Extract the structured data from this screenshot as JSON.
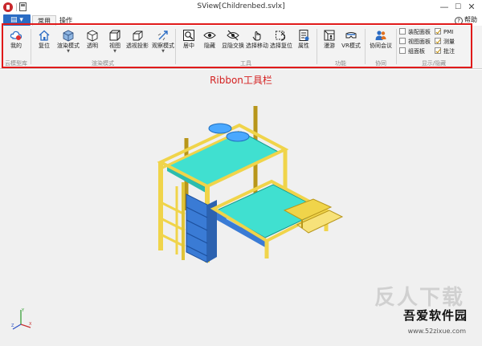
{
  "window": {
    "title": "SView[Childrenbed.svlx]"
  },
  "window_controls": {
    "minimize": "—",
    "maximize": "☐",
    "close": "✕"
  },
  "tabs": [
    {
      "label": "常用",
      "active": true
    },
    {
      "label": "操作",
      "active": false
    }
  ],
  "help": {
    "label": "帮助"
  },
  "ribbon": {
    "groups": [
      {
        "label": "云模型库",
        "buttons": [
          {
            "label": "我的",
            "icon": "cloud-icon"
          }
        ]
      },
      {
        "label": "渲染模式",
        "buttons": [
          {
            "label": "复位",
            "icon": "home-icon"
          },
          {
            "label": "渲染模式",
            "icon": "shaded-cube-icon",
            "dropdown": true
          },
          {
            "label": "透明",
            "icon": "transparent-cube-icon"
          },
          {
            "label": "视图",
            "icon": "view-cube-icon",
            "dropdown": true
          },
          {
            "label": "透视投影",
            "icon": "perspective-cube-icon"
          },
          {
            "label": "观察模式",
            "icon": "observe-mode-icon",
            "dropdown": true
          }
        ]
      },
      {
        "label": "工具",
        "buttons": [
          {
            "label": "居中",
            "icon": "center-icon"
          },
          {
            "label": "隐藏",
            "icon": "eye-icon"
          },
          {
            "label": "显隐交换",
            "icon": "swap-visibility-icon"
          },
          {
            "label": "选择移动",
            "icon": "hand-move-icon"
          },
          {
            "label": "选择复位",
            "icon": "select-reset-icon"
          },
          {
            "label": "属性",
            "icon": "properties-icon"
          }
        ]
      },
      {
        "label": "功能",
        "buttons": [
          {
            "label": "漫游",
            "icon": "walkthrough-icon"
          },
          {
            "label": "VR模式",
            "icon": "vr-headset-icon"
          }
        ]
      },
      {
        "label": "协同",
        "buttons": [
          {
            "label": "协同会议",
            "icon": "meeting-icon"
          }
        ]
      },
      {
        "label": "显示/隐藏",
        "checkboxes": [
          {
            "label": "装配面板",
            "checked": false
          },
          {
            "label": "视图面板",
            "checked": false
          },
          {
            "label": "组面板",
            "checked": false
          },
          {
            "label": "PMI",
            "checked": true
          },
          {
            "label": "测量",
            "checked": true
          },
          {
            "label": "批注",
            "checked": true
          }
        ]
      }
    ]
  },
  "viewport": {
    "caption": "Ribbon工具栏"
  },
  "watermark": {
    "big": "反人下载",
    "text": "吾爱软件园",
    "url": "www.52zixue.com"
  },
  "colors": {
    "accent": "#2b6cc4",
    "highlight_frame": "#e01a1a",
    "caption": "#d42020",
    "bed_frame": "#f0d44a",
    "mattress": "#40e0d0",
    "drawers": "#3a7bd5"
  }
}
